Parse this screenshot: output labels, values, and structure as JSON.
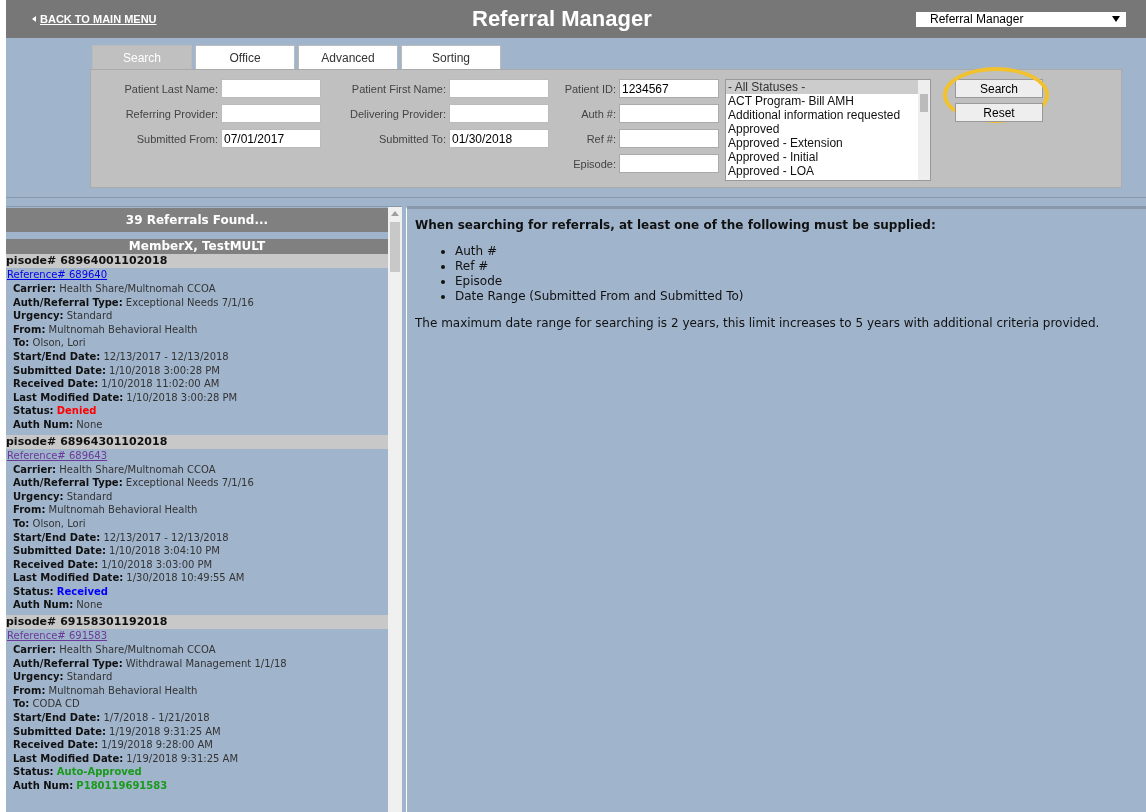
{
  "header": {
    "back_link": "BACK TO MAIN MENU",
    "title": "Referral Manager",
    "module_select": "Referral Manager"
  },
  "tabs": [
    {
      "label": "Search",
      "selected": true
    },
    {
      "label": "Office",
      "selected": false
    },
    {
      "label": "Advanced",
      "selected": false
    },
    {
      "label": "Sorting",
      "selected": false
    }
  ],
  "search_form": {
    "columns": [
      [
        {
          "label": "Patient Last Name:"
        },
        {
          "label": "Referring Provider:"
        },
        {
          "label": "Submitted From:",
          "value": "07/01/2017"
        }
      ],
      [
        {
          "label": "Patient First Name:"
        },
        {
          "label": "Delivering Provider:"
        },
        {
          "label": "Submitted To:",
          "value": "01/30/2018"
        }
      ],
      [
        {
          "label": "Patient ID:",
          "value": "1234567"
        },
        {
          "label": "Auth #:"
        },
        {
          "label": "Ref #:"
        },
        {
          "label": "Episode:"
        }
      ]
    ],
    "status_list": [
      {
        "label": "- All Statuses -",
        "selected": true
      },
      {
        "label": "ACT Program- Bill AMH",
        "selected": false
      },
      {
        "label": "Additional information requested",
        "selected": false
      },
      {
        "label": "Approved",
        "selected": false
      },
      {
        "label": "Approved - Extension",
        "selected": false
      },
      {
        "label": "Approved - Initial",
        "selected": false
      },
      {
        "label": "Approved - LOA",
        "selected": false
      }
    ],
    "buttons": [
      {
        "label": "Search",
        "highlighted": true
      },
      {
        "label": "Reset",
        "highlighted": false
      }
    ]
  },
  "results": {
    "count_title": "39 Referrals Found...",
    "member": "MemberX, TestMULT",
    "referrals": [
      {
        "episode": "pisode# 68964001102018",
        "reference": "Reference# 689640",
        "visited": false,
        "fields": [
          {
            "label": "Carrier:",
            "value": "Health Share/Multnomah CCOA"
          },
          {
            "label": "Auth/Referral Type:",
            "value": "Exceptional Needs 7/1/16"
          },
          {
            "label": "Urgency:",
            "value": "Standard"
          },
          {
            "label": "From:",
            "value": "Multnomah Behavioral Health"
          },
          {
            "label": "To:",
            "value": "Olson, Lori"
          },
          {
            "label": "Start/End Date:",
            "value": "12/13/2017 - 12/13/2018"
          },
          {
            "label": "Submitted Date:",
            "value": "1/10/2018 3:00:28 PM"
          },
          {
            "label": "Received Date:",
            "value": "1/10/2018 11:02:00 AM"
          },
          {
            "label": "Last Modified Date:",
            "value": "1/10/2018 3:00:28 PM"
          }
        ],
        "status": {
          "label": "Status:",
          "value": "Denied",
          "color": "#ff0000"
        },
        "auth_num": {
          "label": "Auth Num:",
          "value": "None",
          "color": "#333333"
        }
      },
      {
        "episode": "pisode# 68964301102018",
        "reference": "Reference# 689643",
        "visited": true,
        "fields": [
          {
            "label": "Carrier:",
            "value": "Health Share/Multnomah CCOA"
          },
          {
            "label": "Auth/Referral Type:",
            "value": "Exceptional Needs 7/1/16"
          },
          {
            "label": "Urgency:",
            "value": "Standard"
          },
          {
            "label": "From:",
            "value": "Multnomah Behavioral Health"
          },
          {
            "label": "To:",
            "value": "Olson, Lori"
          },
          {
            "label": "Start/End Date:",
            "value": "12/13/2017 - 12/13/2018"
          },
          {
            "label": "Submitted Date:",
            "value": "1/10/2018 3:04:10 PM"
          },
          {
            "label": "Received Date:",
            "value": "1/10/2018 3:03:00 PM"
          },
          {
            "label": "Last Modified Date:",
            "value": "1/30/2018 10:49:55 AM"
          }
        ],
        "status": {
          "label": "Status:",
          "value": "Received",
          "color": "#0000ff"
        },
        "auth_num": {
          "label": "Auth Num:",
          "value": "None",
          "color": "#333333"
        }
      },
      {
        "episode": "pisode# 69158301192018",
        "reference": "Reference# 691583",
        "visited": true,
        "fields": [
          {
            "label": "Carrier:",
            "value": "Health Share/Multnomah CCOA"
          },
          {
            "label": "Auth/Referral Type:",
            "value": "Withdrawal Management 1/1/18"
          },
          {
            "label": "Urgency:",
            "value": "Standard"
          },
          {
            "label": "From:",
            "value": "Multnomah Behavioral Health"
          },
          {
            "label": "To:",
            "value": "CODA CD"
          },
          {
            "label": "Start/End Date:",
            "value": "1/7/2018 - 1/21/2018"
          },
          {
            "label": "Submitted Date:",
            "value": "1/19/2018 9:31:25 AM"
          },
          {
            "label": "Received Date:",
            "value": "1/19/2018 9:28:00 AM"
          },
          {
            "label": "Last Modified Date:",
            "value": "1/19/2018 9:31:25 AM"
          }
        ],
        "status": {
          "label": "Status:",
          "value": "Auto-Approved",
          "color": "#1a9a1a"
        },
        "auth_num": {
          "label": "Auth Num:",
          "value": "P180119691583",
          "color": "#1a9a1a"
        }
      }
    ]
  },
  "help": {
    "heading": "When searching for referrals, at least one of the following must be supplied:",
    "items": [
      "Auth #",
      "Ref #",
      "Episode",
      "Date Range (Submitted From and Submitted To)"
    ],
    "note": "The maximum date range for searching is 2 years, this limit increases to 5 years with additional criteria provided."
  }
}
